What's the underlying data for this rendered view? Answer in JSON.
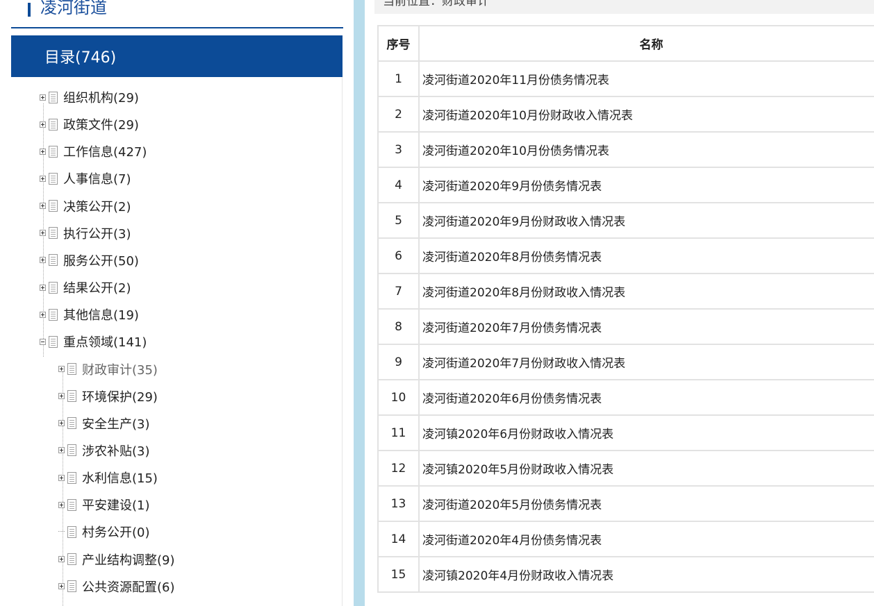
{
  "site": {
    "title": "凌河街道"
  },
  "directory": {
    "header": "目录(746)"
  },
  "tree": [
    {
      "label": "组织机构(29)",
      "level": 1,
      "toggle": "plus"
    },
    {
      "label": "政策文件(29)",
      "level": 1,
      "toggle": "plus"
    },
    {
      "label": "工作信息(427)",
      "level": 1,
      "toggle": "plus"
    },
    {
      "label": "人事信息(7)",
      "level": 1,
      "toggle": "plus"
    },
    {
      "label": "决策公开(2)",
      "level": 1,
      "toggle": "plus"
    },
    {
      "label": "执行公开(3)",
      "level": 1,
      "toggle": "plus"
    },
    {
      "label": "服务公开(50)",
      "level": 1,
      "toggle": "plus"
    },
    {
      "label": "结果公开(2)",
      "level": 1,
      "toggle": "plus"
    },
    {
      "label": "其他信息(19)",
      "level": 1,
      "toggle": "plus"
    },
    {
      "label": "重点领域(141)",
      "level": 1,
      "toggle": "minus"
    },
    {
      "label": "财政审计(35)",
      "level": 2,
      "toggle": "plus",
      "selected": true
    },
    {
      "label": "环境保护(29)",
      "level": 2,
      "toggle": "plus"
    },
    {
      "label": "安全生产(3)",
      "level": 2,
      "toggle": "plus"
    },
    {
      "label": "涉农补贴(3)",
      "level": 2,
      "toggle": "plus"
    },
    {
      "label": "水利信息(15)",
      "level": 2,
      "toggle": "plus"
    },
    {
      "label": "平安建设(1)",
      "level": 2,
      "toggle": "plus"
    },
    {
      "label": "村务公开(0)",
      "level": 2,
      "toggle": "none"
    },
    {
      "label": "产业结构调整(9)",
      "level": 2,
      "toggle": "plus"
    },
    {
      "label": "公共资源配置(6)",
      "level": 2,
      "toggle": "plus"
    }
  ],
  "breadcrumb": {
    "text": "当前位置：财政审计"
  },
  "table": {
    "headers": {
      "index": "序号",
      "name": "名称"
    },
    "rows": [
      {
        "index": "1",
        "name": "凌河街道2020年11月份债务情况表"
      },
      {
        "index": "2",
        "name": "凌河街道2020年10月份财政收入情况表"
      },
      {
        "index": "3",
        "name": "凌河街道2020年10月份债务情况表"
      },
      {
        "index": "4",
        "name": "凌河街道2020年9月份债务情况表"
      },
      {
        "index": "5",
        "name": "凌河街道2020年9月份财政收入情况表"
      },
      {
        "index": "6",
        "name": "凌河街道2020年8月份债务情况表"
      },
      {
        "index": "7",
        "name": "凌河街道2020年8月份财政收入情况表"
      },
      {
        "index": "8",
        "name": "凌河街道2020年7月份债务情况表"
      },
      {
        "index": "9",
        "name": "凌河街道2020年7月份财政收入情况表"
      },
      {
        "index": "10",
        "name": "凌河街道2020年6月份债务情况表"
      },
      {
        "index": "11",
        "name": "凌河镇2020年6月份财政收入情况表"
      },
      {
        "index": "12",
        "name": "凌河镇2020年5月份财政收入情况表"
      },
      {
        "index": "13",
        "name": "凌河街道2020年5月份债务情况表"
      },
      {
        "index": "14",
        "name": "凌河街道2020年4月份债务情况表"
      },
      {
        "index": "15",
        "name": "凌河镇2020年4月份财政收入情况表"
      }
    ]
  },
  "colors": {
    "primary": "#0c4b97",
    "separator": "#b8dceb"
  },
  "icons": {
    "expand": "plus-box-icon",
    "collapse": "minus-box-icon",
    "document": "document-icon"
  }
}
